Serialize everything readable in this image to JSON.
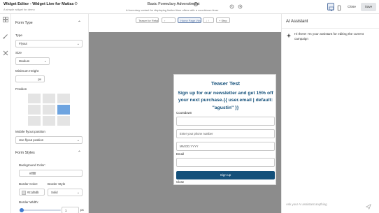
{
  "header": {
    "title": "Widget Editor - Widget Live for Matias",
    "subtitle": "A simple widget for demo",
    "campaign_title": "Basic Formulary Adversitment",
    "campaign_subtitle": "A formulary variant for displaying limited time offers with a countdown timer",
    "close_label": "Close",
    "save_label": "Save"
  },
  "canvas_toolbar": {
    "teaser_tab": "Teaser for Retai...",
    "homepage_tab": "Home Page View",
    "step_label": "Step"
  },
  "form": {
    "form_type_heading": "Form Type",
    "type_label": "Type",
    "type_value": "Flyout",
    "size_label": "Size",
    "size_value": "Medium",
    "min_height_label": "Minimum Height",
    "min_height_unit": "px",
    "position_label": "Position",
    "position_selected": "middle-right",
    "mobile_pos_label": "Mobile flyout position",
    "mobile_pos_value": "Use flyout position",
    "form_styles_heading": "Form Styles",
    "bg_color_label": "Background Color:",
    "bg_color_value": "#ffffff",
    "border_color_label": "Border Color:",
    "border_color_value": "#z1d5db",
    "border_style_label": "Border Style",
    "border_style_value": "Solid",
    "border_width_label": "Border Width:",
    "border_width_value": "1",
    "border_width_unit": "px"
  },
  "preview": {
    "title": "Teaser Test",
    "headline": "Sign up for our newsletter and get 15% off your next purchase.{{ user.email | default: \"agustin\" }}",
    "countdown_label": "Countdown",
    "phone_placeholder": "Enter your phone number",
    "date_placeholder": "MM.DD.YYYY",
    "email_label": "Email",
    "signup_button": "Sign up",
    "close_link": "Close"
  },
  "assistant": {
    "title": "AI Assistant",
    "message": "Hi there! I'm your assistant for editing the current campaign",
    "input_placeholder": "Ask your AI assistant anything"
  },
  "colors": {
    "brand_blue": "#14507a",
    "accent": "#3f7bd1",
    "canvas_gray": "#8c8c8c"
  }
}
